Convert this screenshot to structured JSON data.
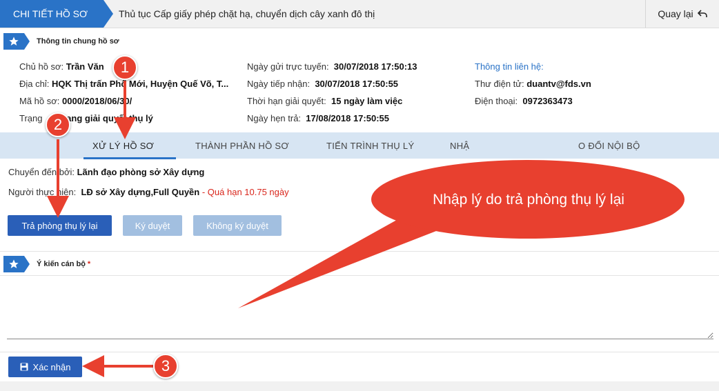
{
  "header": {
    "breadcrumb": "CHI TIẾT HỒ SƠ",
    "title": "Thủ tục Cấp giấy phép chặt hạ, chuyển dịch cây xanh đô thị",
    "back_label": "Quay lại",
    "back_icon": "undo-icon"
  },
  "general_section": {
    "label": "Thông tin chung hồ sơ"
  },
  "general_info": {
    "owner_label": "Chủ hồ sơ:",
    "owner_value": "Trần Văn",
    "address_label": "Địa chỉ:",
    "address_value": "HQK Thị trấn Phố Mới, Huyện Quế Võ, T...",
    "code_label": "Mã hồ sơ:",
    "code_value": "0000/2018/06/30/",
    "status_label": "Trạng",
    "status_value": "Đang giải quyết thụ lý",
    "submit_label": "Ngày gửi trực tuyến:",
    "submit_value": "30/07/2018 17:50:13",
    "receive_label": "Ngày tiếp nhận:",
    "receive_value": "30/07/2018 17:50:55",
    "duration_label": "Thời hạn giải quyết:",
    "duration_value": "15 ngày làm việc",
    "due_label": "Ngày hẹn trả:",
    "due_value": "17/08/2018 17:50:55",
    "contact_title": "Thông tin liên hệ:",
    "email_label": "Thư điện tử:",
    "email_value": "duantv@fds.vn",
    "phone_label": "Điện thoại:",
    "phone_value": "0972363473"
  },
  "tabs": [
    {
      "label": "XỬ LÝ HỒ SƠ",
      "active": true
    },
    {
      "label": "THÀNH PHẦN HỒ SƠ",
      "active": false
    },
    {
      "label": "TIẾN TRÌNH THỤ LÝ",
      "active": false
    },
    {
      "label": "NHẬ",
      "active": false
    },
    {
      "label": "O ĐỔI NỘI BỘ",
      "active": false
    }
  ],
  "processing": {
    "from_label": "Chuyển đến bởi:",
    "from_value": "Lãnh đạo phòng sở Xây dựng",
    "executor_label": "Người thực hiện:",
    "executor_value": "LĐ sở Xây dựng,Full Quyền",
    "overdue_text": "- Quá hạn 10.75 ngày",
    "overdue_color": "#d9261c"
  },
  "actions": {
    "return_label": "Trả phòng thụ lý lại",
    "sign_label": "Ký duyệt",
    "no_sign_label": "Không ký duyệt"
  },
  "opinion_section": {
    "label": "Ý kiến cán bộ",
    "required_mark": "*"
  },
  "opinion_value": "",
  "confirm": {
    "label": "Xác nhận",
    "icon": "save-icon"
  },
  "annotations": {
    "step1": "1",
    "step2": "2",
    "step3": "3",
    "bubble_text": "Nhập lý do trả phòng thụ lý lại",
    "annotation_color": "#e8402f"
  },
  "colors": {
    "primary": "#2a73c7",
    "button_primary": "#2a5fb8",
    "button_disabled": "#a2bfe0",
    "tab_bar": "#d7e5f3"
  }
}
